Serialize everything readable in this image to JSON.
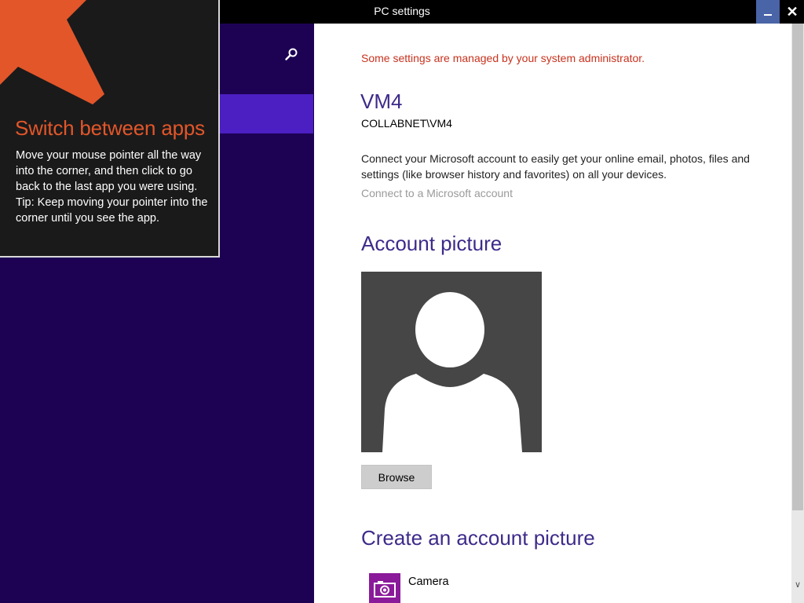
{
  "window": {
    "title": "PC settings",
    "minimize_icon": "minimize-icon",
    "close_label": "✕"
  },
  "left_panel": {
    "search_icon": "search-icon"
  },
  "tip": {
    "heading": "Switch between apps",
    "body_1": "Move your mouse pointer all the way into the corner, and then click to go back to the last app you were using.",
    "body_2": "Tip: Keep moving your pointer into the corner until you see the app.",
    "arrow_color": "#e2562a"
  },
  "content": {
    "admin_note": "Some settings are managed by your system administrator.",
    "user_name": "VM4",
    "user_domain": "COLLABNET\\VM4",
    "ms_description": "Connect your Microsoft account to easily get your online email, photos, files and settings (like browser history and favorites) on all your devices.",
    "ms_link": "Connect to a Microsoft account",
    "account_picture_heading": "Account picture",
    "browse_label": "Browse",
    "create_heading": "Create an account picture",
    "camera_label": "Camera"
  },
  "colors": {
    "accent_purple": "#4b1fc1",
    "nav_background": "#1d0254",
    "heading_color": "#3e2a8a",
    "admin_note_color": "#c8321e",
    "camera_tile": "#8a1a9a"
  }
}
